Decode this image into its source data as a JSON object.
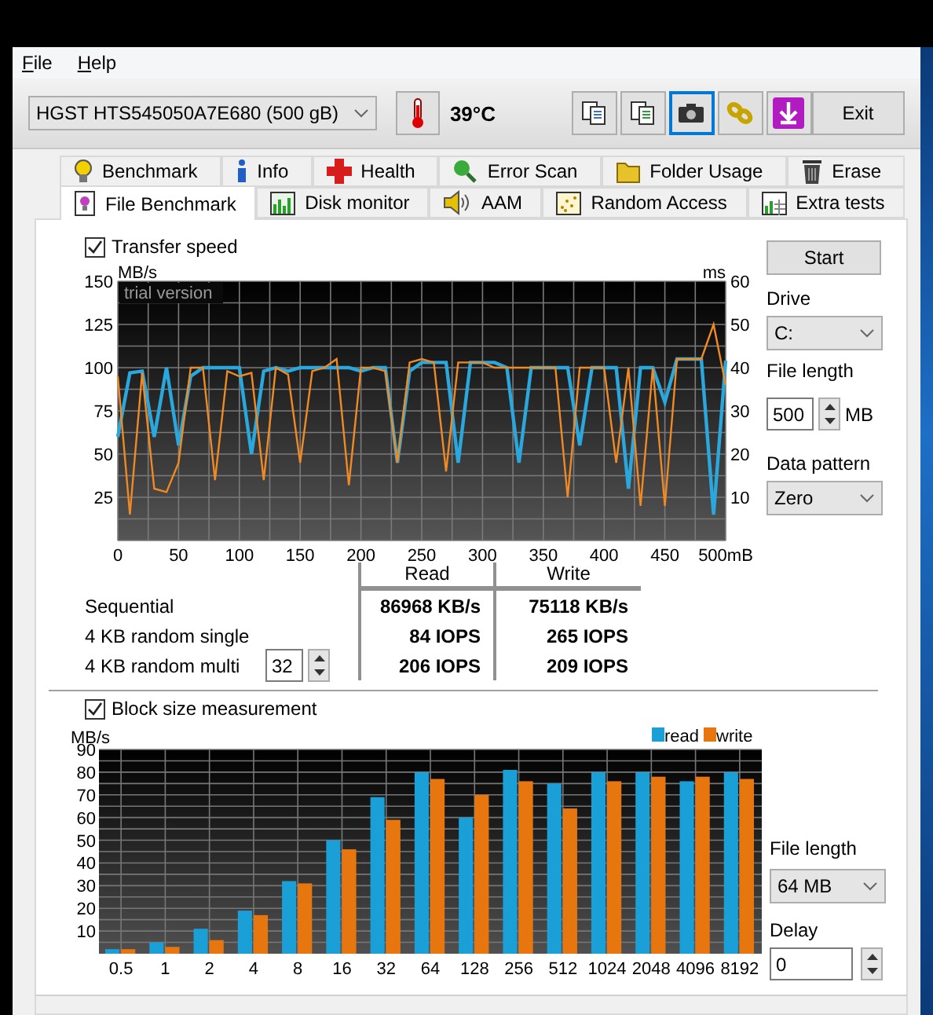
{
  "menu": [
    {
      "label": "File"
    },
    {
      "label": "Help"
    }
  ],
  "toolbar": {
    "drive": "HGST HTS545050A7E680 (500 gB)",
    "temperature": "39°C",
    "exit": "Exit",
    "buttons": [
      {
        "kind": "copy",
        "selected": false
      },
      {
        "kind": "copy-green",
        "selected": false
      },
      {
        "kind": "camera",
        "selected": true
      },
      {
        "kind": "chain",
        "selected": false
      },
      {
        "kind": "save",
        "selected": false
      }
    ]
  },
  "tab_rows": [
    [
      {
        "label": "Benchmark",
        "kind": "bulb",
        "selected": false
      },
      {
        "label": "Info",
        "kind": "info",
        "selected": false
      },
      {
        "label": "Health",
        "kind": "cross",
        "selected": false
      },
      {
        "label": "Error Scan",
        "kind": "magnifier",
        "selected": false
      },
      {
        "label": "Folder Usage",
        "kind": "folder",
        "selected": false
      },
      {
        "label": "Erase",
        "kind": "bin",
        "selected": false
      }
    ],
    [
      {
        "label": "File Benchmark",
        "kind": "file",
        "selected": true
      },
      {
        "label": "Disk monitor",
        "kind": "chart",
        "selected": false
      },
      {
        "label": "AAM",
        "kind": "speaker",
        "selected": false
      },
      {
        "label": "Random Access",
        "kind": "dots",
        "selected": false
      },
      {
        "label": "Extra tests",
        "kind": "grid",
        "selected": false
      }
    ]
  ],
  "transfer": {
    "checkbox": {
      "label": "Transfer speed",
      "checked": true
    },
    "chart_data": {
      "type": "line",
      "ylabel": "MB/s",
      "y2label": "ms",
      "grid": true,
      "annotations": [
        {
          "text": "trial version"
        }
      ],
      "xlim": [
        0,
        500
      ],
      "ylim": [
        0,
        150
      ],
      "y2lim": [
        0,
        60
      ],
      "xticks": [
        0,
        50,
        100,
        150,
        200,
        250,
        300,
        350,
        400,
        450,
        {
          "value": 500,
          "label": "500mB"
        }
      ],
      "yticks": [
        25,
        50,
        75,
        100,
        125,
        150
      ],
      "y2ticks": [
        10,
        20,
        30,
        40,
        50,
        60
      ],
      "x": [
        0,
        10,
        20,
        30,
        40,
        50,
        60,
        70,
        80,
        90,
        100,
        110,
        120,
        130,
        140,
        150,
        160,
        170,
        180,
        190,
        200,
        210,
        220,
        230,
        240,
        250,
        260,
        270,
        280,
        290,
        300,
        310,
        320,
        330,
        340,
        350,
        360,
        370,
        380,
        390,
        400,
        410,
        420,
        430,
        440,
        450,
        460,
        470,
        480,
        490,
        500
      ],
      "series": [
        {
          "color": "#2aa7dc",
          "values": [
            60,
            97,
            98,
            60,
            100,
            55,
            95,
            100,
            100,
            100,
            100,
            50,
            98,
            100,
            98,
            100,
            100,
            100,
            100,
            100,
            98,
            100,
            100,
            45,
            98,
            103,
            103,
            103,
            45,
            103,
            103,
            103,
            100,
            45,
            100,
            100,
            100,
            100,
            55,
            100,
            100,
            100,
            30,
            100,
            100,
            80,
            105,
            105,
            105,
            15,
            104
          ]
        },
        {
          "color": "#f08a24",
          "values": [
            95,
            15,
            97,
            30,
            28,
            45,
            100,
            100,
            35,
            98,
            95,
            97,
            35,
            100,
            96,
            45,
            98,
            100,
            105,
            32,
            100,
            100,
            98,
            45,
            103,
            105,
            103,
            40,
            103,
            103,
            103,
            100,
            100,
            100,
            100,
            100,
            100,
            25,
            100,
            100,
            100,
            45,
            100,
            20,
            100,
            20,
            105,
            105,
            105,
            125,
            90
          ]
        }
      ]
    }
  },
  "results": {
    "columns": [
      "Read",
      "Write"
    ],
    "rows": [
      {
        "label": "Sequential",
        "read": "86968 KB/s",
        "write": "75118 KB/s"
      },
      {
        "label": "4 KB random single",
        "read": "84 IOPS",
        "write": "265 IOPS"
      },
      {
        "label": "4 KB random multi",
        "queue_depth": "32",
        "read": "206 IOPS",
        "write": "209 IOPS"
      }
    ]
  },
  "file_controls": {
    "start": "Start",
    "drive_label": "Drive",
    "drive": "C:",
    "file_length_label": "File length",
    "file_length": "500",
    "unit": "MB",
    "data_pattern_label": "Data pattern",
    "data_pattern": "Zero"
  },
  "block": {
    "checkbox": {
      "label": "Block size measurement",
      "checked": true
    },
    "chart_data": {
      "type": "bar",
      "ylabel": "MB/s",
      "grid": true,
      "legend": true,
      "ylim": [
        0,
        90
      ],
      "yticks": [
        10,
        20,
        30,
        40,
        50,
        60,
        70,
        80,
        90
      ],
      "categories": [
        "0.5",
        "1",
        "2",
        "4",
        "8",
        "16",
        "32",
        "64",
        "128",
        "256",
        "512",
        "1024",
        "2048",
        "4096",
        "8192"
      ],
      "series": [
        {
          "name": "read",
          "color": "#1a9fd6",
          "values": [
            2,
            5,
            11,
            19,
            32,
            50,
            69,
            80,
            60,
            81,
            75,
            80,
            80,
            76,
            80
          ]
        },
        {
          "name": "write",
          "color": "#e8760f",
          "values": [
            2,
            3,
            6,
            17,
            31,
            46,
            59,
            77,
            70,
            76,
            64,
            76,
            78,
            78,
            77
          ]
        }
      ]
    },
    "file_length_label": "File length",
    "file_length": "64 MB",
    "delay_label": "Delay",
    "delay": "0"
  }
}
